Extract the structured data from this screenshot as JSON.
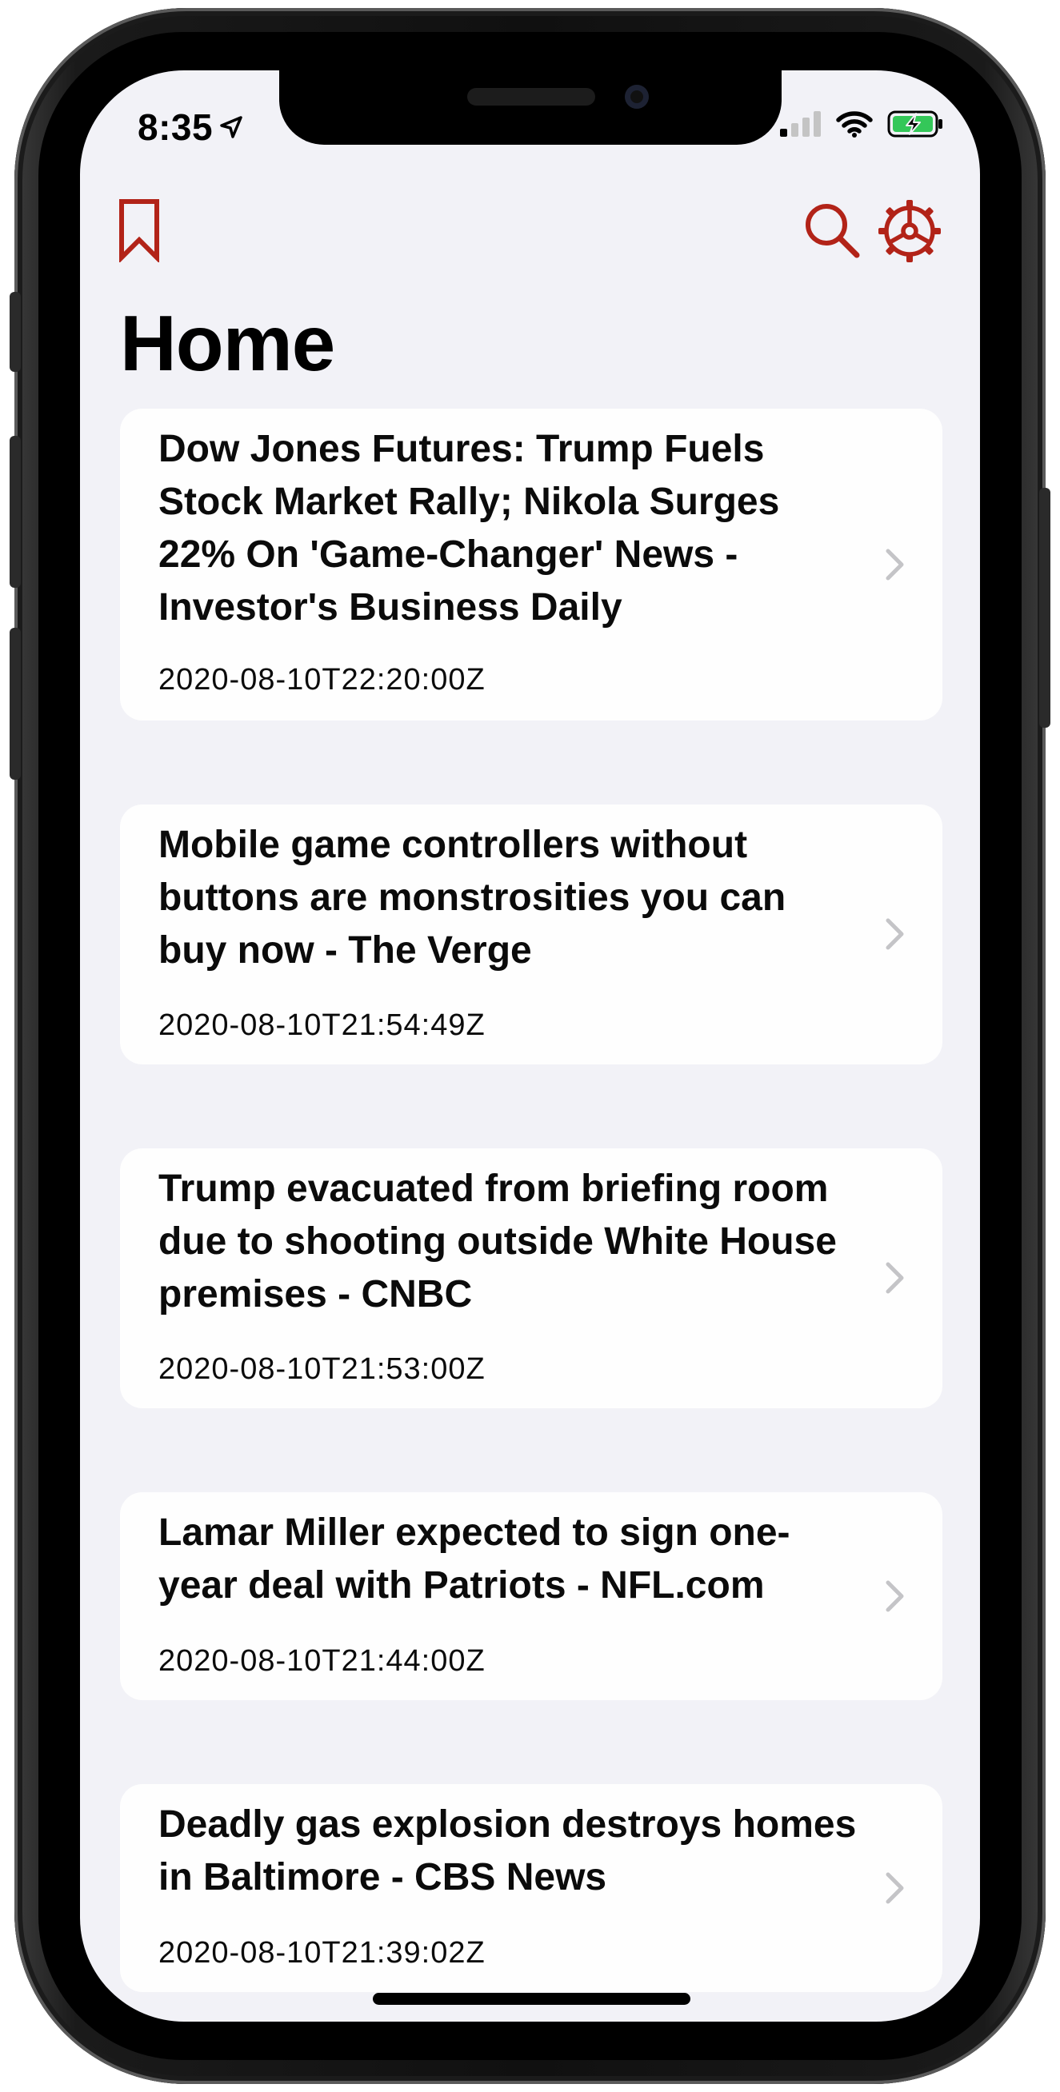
{
  "status_bar": {
    "time": "8:35",
    "icons": [
      "location-arrow-icon",
      "cellular-signal-icon",
      "wifi-icon",
      "battery-charging-icon"
    ]
  },
  "nav": {
    "icons": [
      "bookmark-icon",
      "search-icon",
      "gear-icon"
    ],
    "accent_color": "#b22318"
  },
  "page_title": "Home",
  "articles": [
    {
      "headline": "Dow Jones Futures: Trump Fuels Stock Market Rally; Nikola Surges 22% On 'Game-Changer' News - Investor's Business Daily",
      "published": "2020-08-10T22:20:00Z"
    },
    {
      "headline": "Mobile game controllers without buttons are monstrosities you can buy now - The Verge",
      "published": "2020-08-10T21:54:49Z"
    },
    {
      "headline": "Trump evacuated from briefing room due to shooting outside White House premises - CNBC",
      "published": "2020-08-10T21:53:00Z"
    },
    {
      "headline": "Lamar Miller expected to sign one-year deal with Patriots - NFL.com",
      "published": "2020-08-10T21:44:00Z"
    },
    {
      "headline": "Deadly gas explosion destroys homes in Baltimore - CBS News",
      "published": "2020-08-10T21:39:02Z"
    }
  ]
}
